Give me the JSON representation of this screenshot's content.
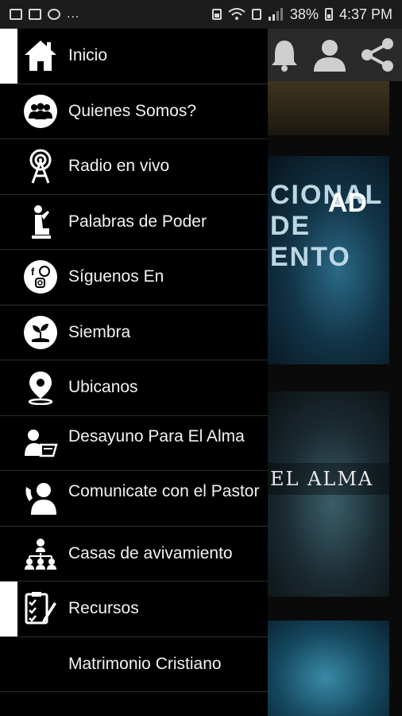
{
  "status_bar": {
    "dots": "...",
    "battery": "38%",
    "time": "4:37 PM"
  },
  "background": {
    "card2_caption": "CIONAL DE ENTO",
    "card2_logo": "AD",
    "card3_caption": "EL ALMA"
  },
  "menu": {
    "items": [
      {
        "label": "Inicio",
        "icon": "home-icon"
      },
      {
        "label": "Quienes Somos?",
        "icon": "group-icon"
      },
      {
        "label": "Radio en vivo",
        "icon": "radio-tower-icon"
      },
      {
        "label": "Palabras de Poder",
        "icon": "praying-icon"
      },
      {
        "label": "Síguenos En",
        "icon": "social-icon"
      },
      {
        "label": "Siembra",
        "icon": "sprout-icon"
      },
      {
        "label": "Ubicanos",
        "icon": "location-pin-icon"
      },
      {
        "label": "Desayuno Para El Alma",
        "icon": "reader-icon"
      },
      {
        "label": "Comunicate con el Pastor",
        "icon": "phone-person-icon"
      },
      {
        "label": "Casas de avivamiento",
        "icon": "network-icon"
      },
      {
        "label": "Recursos",
        "icon": "checklist-icon"
      },
      {
        "label": "Matrimonio Cristiano",
        "icon": ""
      },
      {
        "label": "",
        "icon": ""
      }
    ]
  }
}
